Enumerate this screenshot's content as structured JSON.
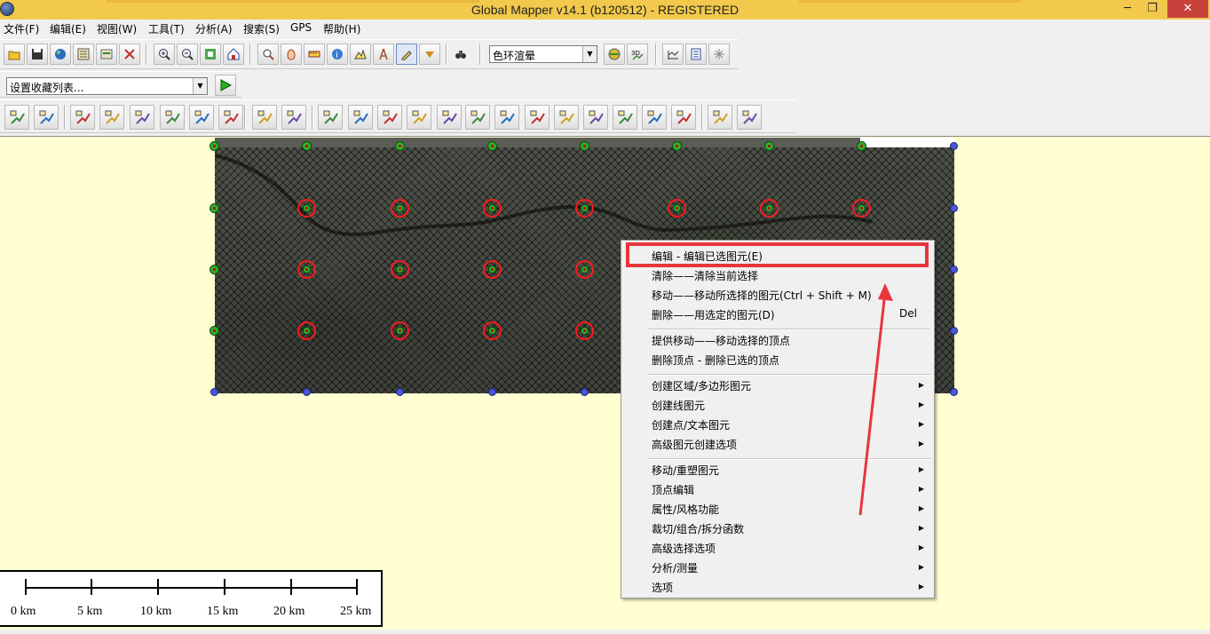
{
  "window": {
    "title": "Global Mapper v14.1 (b120512) - REGISTERED",
    "minimize": "─",
    "maximize": "❐",
    "close": "✕"
  },
  "menubar": [
    "文件(F)",
    "编辑(E)",
    "视图(W)",
    "工具(T)",
    "分析(A)",
    "搜索(S)",
    "GPS",
    "帮助(H)"
  ],
  "toolbar": {
    "render_mode_select": "色环渲晕",
    "favorites_select": "设置收藏列表..."
  },
  "icons": {
    "toolbar_row1": [
      "open-folder-icon",
      "save-icon",
      "globe-icon",
      "layers-icon",
      "config-icon",
      "tools-icon",
      "zoom-in-icon",
      "zoom-out-icon",
      "full-view-icon",
      "home-icon",
      "zoom-tool-icon",
      "pan-hand-icon",
      "measure-icon",
      "info-icon",
      "path-profile-icon",
      "tower-icon",
      "digitize-icon",
      "dropdown-icon",
      "binoculars-icon",
      "shader-icon",
      "3d-view-icon",
      "terrain-icon",
      "print-icon",
      "grid-icon"
    ],
    "toolbar_row3": [
      "create-area-icon",
      "create-line-icon",
      "create-point-icon",
      "create-circle-icon",
      "create-rect-icon",
      "coord-icon",
      "buffer-icon",
      "grid-create-icon",
      "split-icon",
      "vertex-icon",
      "edit-line-icon",
      "edit-area-icon",
      "move-icon",
      "rotate-icon",
      "reshape-icon",
      "smooth-icon",
      "delete-vertex-icon",
      "cut-icon",
      "combine-icon",
      "attribute-icon",
      "style-icon",
      "select-icon",
      "undo-icon",
      "redo-icon",
      "refresh-icon"
    ],
    "run_button": "play-icon"
  },
  "map": {
    "scale_labels": [
      "0 km",
      "5 km",
      "10 km",
      "15 km",
      "20 km",
      "25 km"
    ]
  },
  "context_menu": {
    "groups": [
      [
        {
          "label": "编辑 - 编辑已选图元(E)",
          "shortcut": "",
          "submenu": false,
          "highlighted": true
        },
        {
          "label": "清除——清除当前选择",
          "shortcut": "",
          "submenu": false
        },
        {
          "label": "移动——移动所选择的图元(Ctrl + Shift + M)",
          "shortcut": "",
          "submenu": false
        },
        {
          "label": "删除——用选定的图元(D)",
          "shortcut": "Del",
          "submenu": false
        }
      ],
      [
        {
          "label": "提供移动——移动选择的顶点",
          "shortcut": "",
          "submenu": false
        },
        {
          "label": "删除顶点 - 删除已选的顶点",
          "shortcut": "",
          "submenu": false
        }
      ],
      [
        {
          "label": "创建区域/多边形图元",
          "shortcut": "",
          "submenu": true
        },
        {
          "label": "创建线图元",
          "shortcut": "",
          "submenu": true
        },
        {
          "label": "创建点/文本图元",
          "shortcut": "",
          "submenu": true
        },
        {
          "label": "高级图元创建选项",
          "shortcut": "",
          "submenu": true
        }
      ],
      [
        {
          "label": "移动/重塑图元",
          "shortcut": "",
          "submenu": true
        },
        {
          "label": "顶点编辑",
          "shortcut": "",
          "submenu": true
        },
        {
          "label": "属性/风格功能",
          "shortcut": "",
          "submenu": true
        },
        {
          "label": "裁切/组合/拆分函数",
          "shortcut": "",
          "submenu": true
        },
        {
          "label": "高级选择选项",
          "shortcut": "",
          "submenu": true
        },
        {
          "label": "分析/测量",
          "shortcut": "",
          "submenu": true
        },
        {
          "label": "选项",
          "shortcut": "",
          "submenu": true
        }
      ]
    ],
    "submenu_arrow": "▶"
  },
  "colors": {
    "map_background": "#ffffd2",
    "highlight_annotation": "#e8353c",
    "title_bar": "#f2c94c",
    "vertex_selected": "#ff1a1a",
    "vertex_corner": "#2fae2f",
    "vertex_edge": "#4b57d6"
  }
}
